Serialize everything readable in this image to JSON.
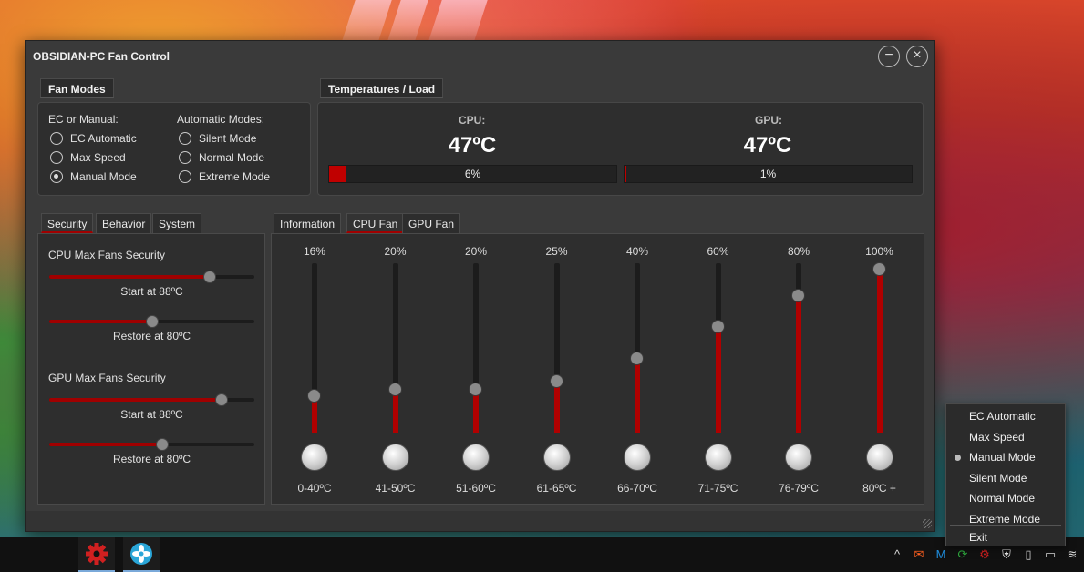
{
  "window": {
    "title": "OBSIDIAN-PC Fan Control",
    "minimize_glyph": "−",
    "close_glyph": "×"
  },
  "fan_modes": {
    "heading": "Fan Modes",
    "ec_heading": "EC or Manual:",
    "auto_heading": "Automatic Modes:",
    "ec_options": [
      {
        "label": "EC Automatic",
        "selected": false
      },
      {
        "label": "Max Speed",
        "selected": false
      },
      {
        "label": "Manual Mode",
        "selected": true
      }
    ],
    "auto_options": [
      {
        "label": "Silent Mode",
        "selected": false
      },
      {
        "label": "Normal Mode",
        "selected": false
      },
      {
        "label": "Extreme Mode",
        "selected": false
      }
    ]
  },
  "temps": {
    "heading": "Temperatures / Load",
    "cpu": {
      "label": "CPU:",
      "temp": "47ºC",
      "load_text": "6%",
      "load": 6
    },
    "gpu": {
      "label": "GPU:",
      "temp": "47ºC",
      "load_text": "1%",
      "load": 1
    }
  },
  "left_tabs": [
    {
      "label": "Security",
      "active": true
    },
    {
      "label": "Behavior",
      "active": false
    },
    {
      "label": "System",
      "active": false
    }
  ],
  "security": {
    "cpu_heading": "CPU Max Fans Security",
    "cpu_start": {
      "label": "Start at 88ºC",
      "value": 0.78
    },
    "cpu_restore": {
      "label": "Restore at 80ºC",
      "value": 0.5
    },
    "gpu_heading": "GPU Max Fans Security",
    "gpu_start": {
      "label": "Start at 88ºC",
      "value": 0.84
    },
    "gpu_restore": {
      "label": "Restore at 80ºC",
      "value": 0.55
    }
  },
  "right_tabs": [
    {
      "label": "Information",
      "active": false
    },
    {
      "label": "CPU Fan",
      "active": true
    },
    {
      "label": "GPU Fan",
      "active": false
    }
  ],
  "fan_curve": [
    {
      "percent_label": "16%",
      "percent": 16,
      "range": "0-40ºC"
    },
    {
      "percent_label": "20%",
      "percent": 20,
      "range": "41-50ºC"
    },
    {
      "percent_label": "20%",
      "percent": 20,
      "range": "51-60ºC"
    },
    {
      "percent_label": "25%",
      "percent": 25,
      "range": "61-65ºC"
    },
    {
      "percent_label": "40%",
      "percent": 40,
      "range": "66-70ºC"
    },
    {
      "percent_label": "60%",
      "percent": 60,
      "range": "71-75ºC"
    },
    {
      "percent_label": "80%",
      "percent": 80,
      "range": "76-79ºC"
    },
    {
      "percent_label": "100%",
      "percent": 100,
      "range": "80ºC +"
    }
  ],
  "context_menu": [
    {
      "label": "EC Automatic",
      "selected": false
    },
    {
      "label": "Max Speed",
      "selected": false
    },
    {
      "label": "Manual Mode",
      "selected": true
    },
    {
      "label": "Silent Mode",
      "selected": false
    },
    {
      "label": "Normal Mode",
      "selected": false
    },
    {
      "label": "Extreme Mode",
      "selected": false
    },
    {
      "label": "Exit",
      "selected": false
    }
  ],
  "taskbar": {
    "apps": [
      "gear-icon",
      "fan-icon"
    ],
    "tray": [
      "chevron-up-icon",
      "mail-icon",
      "m-icon",
      "refresh-icon",
      "gear-icon",
      "shield-icon",
      "usb-icon",
      "battery-icon",
      "wifi-icon"
    ],
    "tray_glyphs": [
      "^",
      "✉",
      "M",
      "⟳",
      "⚙",
      "⛨",
      "▯",
      "▭",
      "≋"
    ]
  },
  "colors": {
    "accent": "#a00000",
    "window_bg": "#3a3a3a",
    "panel_bg": "#2e2e2e"
  }
}
